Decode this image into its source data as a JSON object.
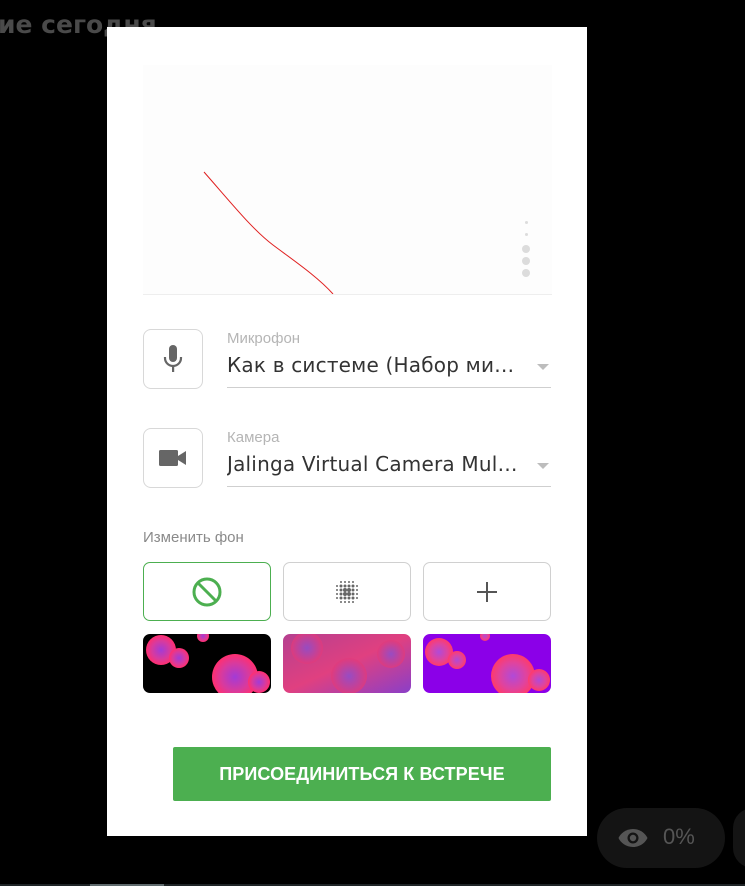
{
  "background": {
    "title_fragment": "ие сегодня",
    "views_percent": "0%"
  },
  "devices": {
    "microphone": {
      "label": "Микрофон",
      "value": "Как в системе (Набор микрофонов)",
      "icon": "microphone-icon"
    },
    "camera": {
      "label": "Камера",
      "value": "Jalinga Virtual Camera Multistream",
      "icon": "video-camera-icon"
    }
  },
  "background_picker": {
    "heading": "Изменить фон",
    "options": [
      {
        "name": "no-background",
        "icon": "no-symbol-icon"
      },
      {
        "name": "blur-background",
        "icon": "blur-icon"
      },
      {
        "name": "add-background",
        "icon": "plus-icon"
      }
    ],
    "thumbnails": [
      {
        "name": "blobs-on-black"
      },
      {
        "name": "blobs-on-purple-pink"
      },
      {
        "name": "blobs-on-violet"
      }
    ]
  },
  "actions": {
    "join_label": "ПРИСОЕДИНИТЬСЯ К ВСТРЕЧЕ"
  },
  "colors": {
    "accent": "#4caf50",
    "overlay": "#000000",
    "dialog": "#ffffff"
  }
}
